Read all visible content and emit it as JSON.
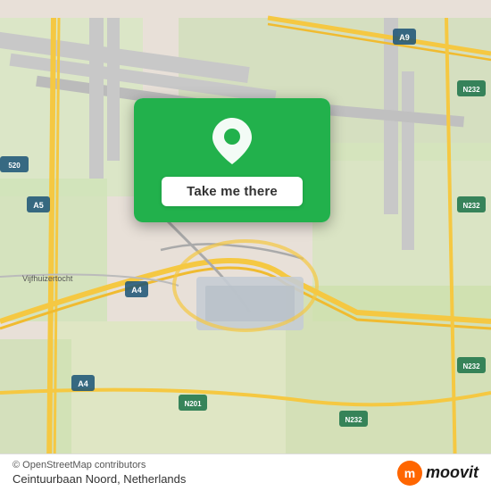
{
  "map": {
    "background_color": "#e8e0d8",
    "attribution": "© OpenStreetMap contributors",
    "location_name": "Ceintuurbaan Noord, Netherlands"
  },
  "popup": {
    "button_label": "Take me there",
    "pin_color": "#ffffff"
  },
  "moovit": {
    "logo_text": "moovit",
    "logo_color": "#ff6600"
  }
}
